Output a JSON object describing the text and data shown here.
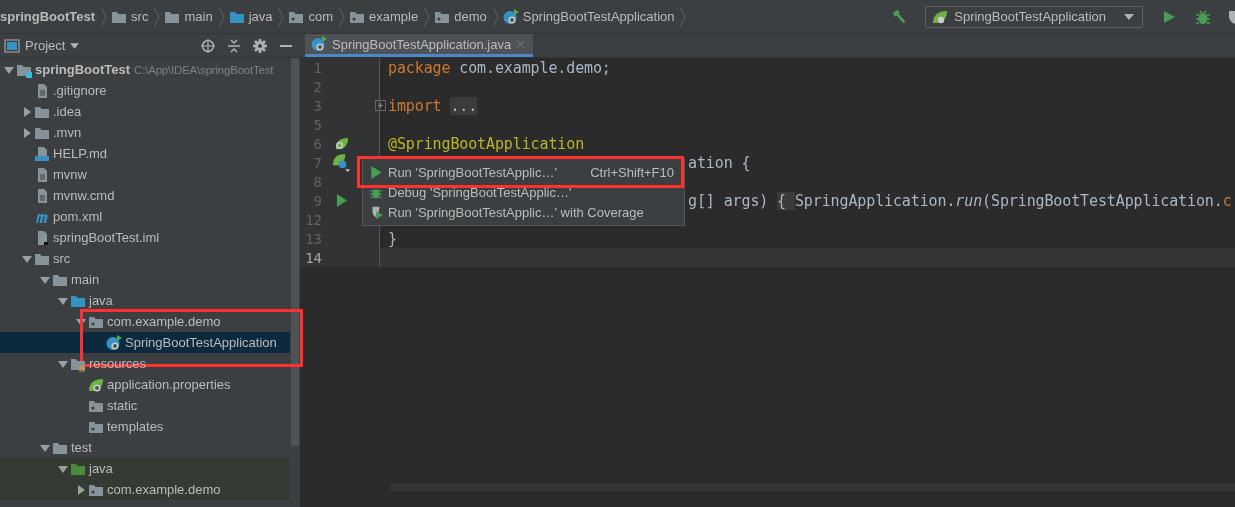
{
  "breadcrumb": [
    {
      "label": "springBootTest",
      "kind": "project"
    },
    {
      "label": "src",
      "kind": "folder"
    },
    {
      "label": "main",
      "kind": "folder"
    },
    {
      "label": "java",
      "kind": "source-folder"
    },
    {
      "label": "com",
      "kind": "package"
    },
    {
      "label": "example",
      "kind": "package"
    },
    {
      "label": "demo",
      "kind": "package"
    },
    {
      "label": "SpringBootTestApplication",
      "kind": "spring-class"
    }
  ],
  "toolbar": {
    "run_config": "SpringBootTestApplication",
    "buttons": [
      {
        "kind": "build"
      },
      {
        "kind": "run"
      },
      {
        "kind": "debug"
      },
      {
        "kind": "coverage"
      }
    ]
  },
  "project_panel": {
    "title": "Project",
    "tools": [
      {
        "kind": "locate"
      },
      {
        "kind": "collapse"
      },
      {
        "kind": "settings"
      },
      {
        "kind": "hide"
      }
    ]
  },
  "tabs": [
    {
      "label": "SpringBootTestApplication.java",
      "kind": "spring-class",
      "selected": true
    }
  ],
  "tree": {
    "items": [
      {
        "label": "springBootTest",
        "note": "C:\\App\\IDEA\\springBootTest",
        "kind": "module",
        "expanded": true,
        "selected": false,
        "tinted": false,
        "callout": false,
        "children": [
          {
            "label": ".gitignore",
            "kind": "text-file",
            "selected": false,
            "tinted": false,
            "callout": false
          },
          {
            "label": ".idea",
            "kind": "folder",
            "expanded": false,
            "selected": false,
            "tinted": false,
            "callout": false
          },
          {
            "label": ".mvn",
            "kind": "folder",
            "expanded": false,
            "selected": false,
            "tinted": false,
            "callout": false
          },
          {
            "label": "HELP.md",
            "kind": "markdown",
            "selected": false,
            "tinted": false,
            "callout": false
          },
          {
            "label": "mvnw",
            "kind": "text-file",
            "selected": false,
            "tinted": false,
            "callout": false
          },
          {
            "label": "mvnw.cmd",
            "kind": "text-file",
            "selected": false,
            "tinted": false,
            "callout": false
          },
          {
            "label": "pom.xml",
            "kind": "maven",
            "selected": false,
            "tinted": false,
            "callout": false
          },
          {
            "label": "springBootTest.iml",
            "kind": "module-file",
            "selected": false,
            "tinted": false,
            "callout": false
          },
          {
            "label": "src",
            "kind": "folder",
            "expanded": true,
            "selected": false,
            "tinted": false,
            "callout": false,
            "children": [
              {
                "label": "main",
                "kind": "folder",
                "expanded": true,
                "selected": false,
                "tinted": false,
                "callout": false,
                "children": [
                  {
                    "label": "java",
                    "kind": "source-folder",
                    "expanded": true,
                    "selected": false,
                    "tinted": false,
                    "callout": false,
                    "children": [
                      {
                        "label": "com.example.demo",
                        "kind": "package",
                        "expanded": true,
                        "selected": false,
                        "tinted": false,
                        "callout": true,
                        "children": [
                          {
                            "label": "SpringBootTestApplication",
                            "kind": "spring-class",
                            "selected": true,
                            "tinted": false,
                            "callout": false
                          }
                        ]
                      }
                    ]
                  },
                  {
                    "label": "resources",
                    "kind": "resource-folder",
                    "expanded": true,
                    "selected": false,
                    "tinted": false,
                    "callout": false,
                    "children": [
                      {
                        "label": "application.properties",
                        "kind": "spring-properties",
                        "selected": false,
                        "tinted": false,
                        "callout": false
                      },
                      {
                        "label": "static",
                        "kind": "package",
                        "selected": false,
                        "tinted": false,
                        "callout": false
                      },
                      {
                        "label": "templates",
                        "kind": "package",
                        "selected": false,
                        "tinted": false,
                        "callout": false
                      }
                    ]
                  }
                ]
              },
              {
                "label": "test",
                "kind": "folder",
                "expanded": true,
                "selected": false,
                "tinted": false,
                "callout": false,
                "children": [
                  {
                    "label": "java",
                    "kind": "test-folder",
                    "expanded": true,
                    "selected": false,
                    "tinted": true,
                    "callout": false,
                    "children": [
                      {
                        "label": "com.example.demo",
                        "kind": "package",
                        "expanded": false,
                        "selected": false,
                        "tinted": true,
                        "callout": false
                      }
                    ]
                  }
                ]
              }
            ]
          }
        ]
      }
    ]
  },
  "editor": {
    "lines": [
      {
        "number": "1",
        "current": false,
        "segments": [
          {
            "kind": "keyword",
            "text": "package"
          },
          {
            "kind": "plain",
            "text": " com.example.demo;"
          }
        ]
      },
      {
        "number": "2",
        "current": false
      },
      {
        "number": "3",
        "current": false,
        "fold_marker": {
          "kind": "expand"
        },
        "segments": [
          {
            "kind": "keyword",
            "text": "import "
          },
          {
            "kind": "folded",
            "text": "..."
          }
        ]
      },
      {
        "number": "5",
        "current": false
      },
      {
        "number": "6",
        "current": false,
        "marker": {
          "kind": "bean"
        },
        "segments": [
          {
            "kind": "annotation",
            "text": "@SpringBootApplication"
          }
        ]
      },
      {
        "number": "7",
        "current": false,
        "marker": {
          "kind": "class"
        },
        "partial": true,
        "segments": [
          {
            "kind": "plain",
            "text": "ation {"
          }
        ]
      },
      {
        "number": "8",
        "current": false
      },
      {
        "number": "9",
        "current": false,
        "marker": {
          "kind": "run"
        },
        "partial": true,
        "segments": [
          {
            "kind": "plain",
            "text": "g[] args) "
          },
          {
            "kind": "folded",
            "text": "{ "
          },
          {
            "kind": "plain",
            "text": "SpringApplication."
          },
          {
            "kind": "method",
            "text": "run"
          },
          {
            "kind": "plain",
            "text": "(SpringBootTestApplication."
          },
          {
            "kind": "keyword",
            "text": "c"
          }
        ]
      },
      {
        "number": "12",
        "current": false
      },
      {
        "number": "13",
        "current": false,
        "segments": [
          {
            "kind": "plain",
            "text": "}"
          }
        ]
      },
      {
        "number": "14",
        "current": true
      }
    ],
    "popup": [
      {
        "kind": "run",
        "label": "Run 'SpringBootTestApplic…'",
        "shortcut": "Ctrl+Shift+F10",
        "callout": true
      },
      {
        "kind": "debug",
        "label": "Debug 'SpringBootTestApplic…'",
        "callout": false
      },
      {
        "kind": "coverage",
        "label": "Run 'SpringBootTestApplic…' with Coverage",
        "callout": false
      }
    ]
  }
}
